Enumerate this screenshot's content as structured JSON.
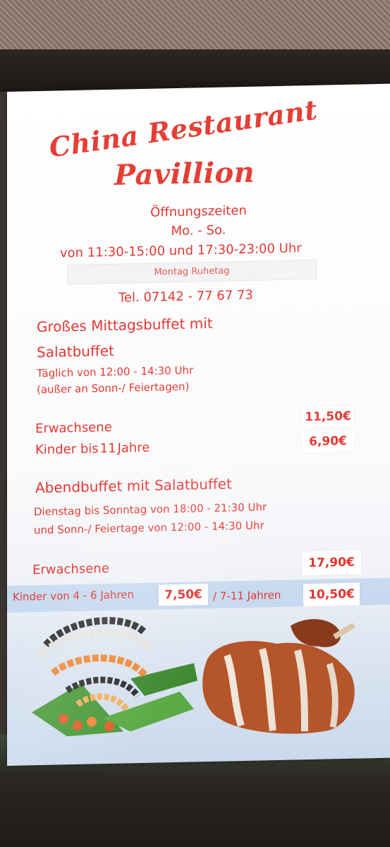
{
  "title": {
    "line1": "China Restaurant",
    "line2": "Pavillion"
  },
  "hours": {
    "heading": "Öffnungszeiten",
    "days": "Mo. - So.",
    "times": "von 11:30-15:00 und 17:30-23:00 Uhr",
    "closed": "Montag Ruhetag",
    "phone": "Tel. 07142 - 77 67 73"
  },
  "lunch": {
    "heading1": "Großes Mittagsbuffet mit",
    "heading2": "Salatbuffet",
    "schedule1": "Täglich von 12:00 - 14:30 Uhr",
    "schedule2": "(außer an Sonn-/ Feiertagen)",
    "adults_label": "Erwachsene",
    "adults_price": "11,50€",
    "kids_label_pre": "Kinder bis",
    "kids_age": "11",
    "kids_label_post": "Jahre",
    "kids_price": "6,90€"
  },
  "dinner": {
    "heading": "Abendbuffet mit Salatbuffet",
    "schedule1": "Dienstag bis Sonntag von 18:00 - 21:30 Uhr",
    "schedule2": "und Sonn-/ Feiertage von 12:00 - 14:30 Uhr",
    "adults_label": "Erwachsene",
    "adults_price": "17,90€",
    "kids_label1": "Kinder von 4 - 6 Jahren",
    "kids_price1": "7,50€",
    "kids_label2": "/ 7-11 Jahren",
    "kids_price2": "10,50€"
  },
  "colors": {
    "text_red": "#e43731",
    "sheet": "#ffffff",
    "band_blue": "#aac8eb"
  }
}
